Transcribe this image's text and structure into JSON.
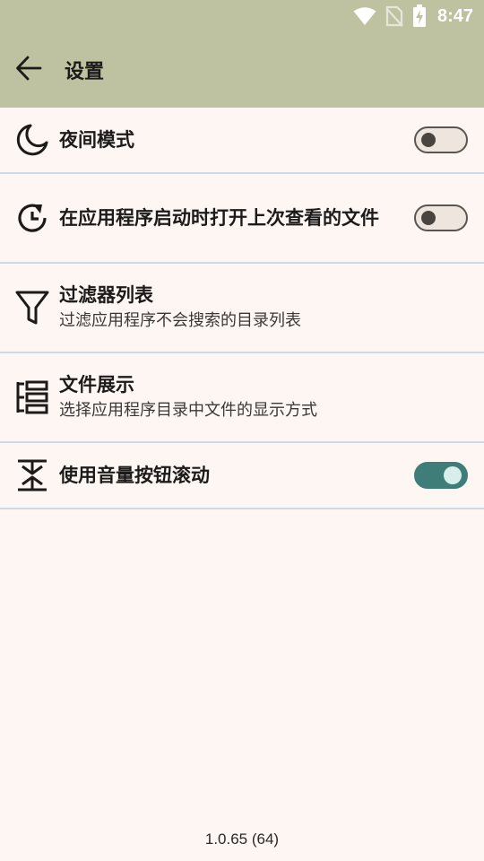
{
  "status_bar": {
    "time": "8:47",
    "icons": [
      "wifi-icon",
      "no-sim-icon",
      "battery-charging-icon"
    ]
  },
  "app_bar": {
    "back_icon": "arrow-left-icon",
    "title": "设置"
  },
  "settings": [
    {
      "icon": "moon-icon",
      "title": "夜间模式",
      "toggle": false
    },
    {
      "icon": "history-icon",
      "title": "在应用程序启动时打开上次查看的文件",
      "toggle": false
    },
    {
      "icon": "filter-icon",
      "title": "过滤器列表",
      "subtitle": "过滤应用程序不会搜索的目录列表"
    },
    {
      "icon": "list-view-icon",
      "title": "文件展示",
      "subtitle": "选择应用程序目录中文件的显示方式"
    },
    {
      "icon": "volume-scroll-icon",
      "title": "使用音量按钮滚动",
      "toggle": true
    }
  ],
  "version": "1.0.65 (64)",
  "colors": {
    "header": "#bfc2a0",
    "background": "#fdf6f3",
    "divider": "#c9dbe6",
    "toggle_on": "#3e7d78"
  }
}
